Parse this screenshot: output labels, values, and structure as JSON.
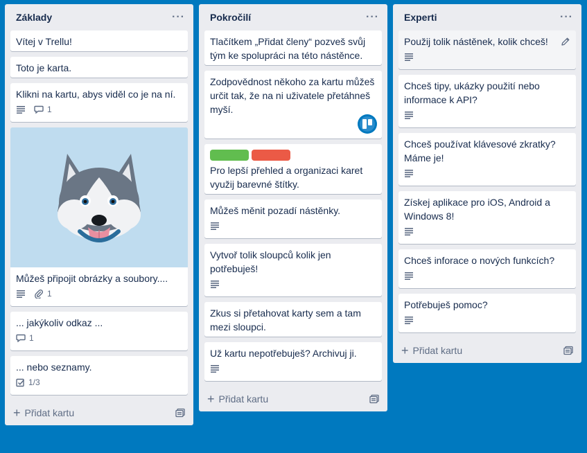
{
  "lists": [
    {
      "title": "Základy",
      "menu": "···",
      "cards": [
        {
          "text": "Vítej v Trellu!"
        },
        {
          "text": "Toto je karta."
        },
        {
          "text": "Klikni na kartu, abys viděl co je na ní.",
          "comments": "1"
        },
        {
          "text": "Můžeš připojit obrázky a soubory....",
          "attachments": "1"
        },
        {
          "text": "... jakýkoliv odkaz ...",
          "comments": "1"
        },
        {
          "text": "... nebo seznamy.",
          "checklist": "1/3"
        }
      ],
      "add_card": "Přidat kartu"
    },
    {
      "title": "Pokročilí",
      "menu": "···",
      "cards": [
        {
          "text": "Tlačítkem „Přidat členy“ pozveš svůj tým ke spolupráci na této nástěnce."
        },
        {
          "text": "Zodpovědnost někoho za kartu můžeš určit tak, že na ni uživatele přetáhneš myší."
        },
        {
          "text": "Pro lepší přehled a organizaci karet využij barevné štítky."
        },
        {
          "text": "Můžeš měnit pozadí nástěnky."
        },
        {
          "text": "Vytvoř tolik sloupců kolik jen potřebuješ!"
        },
        {
          "text": "Zkus si přetahovat karty sem a tam mezi sloupci."
        },
        {
          "text": "Už kartu nepotřebuješ? Archivuj ji."
        }
      ],
      "add_card": "Přidat kartu"
    },
    {
      "title": "Experti",
      "menu": "···",
      "cards": [
        {
          "text": "Použij tolik nástěnek, kolik chceš!"
        },
        {
          "text": "Chceš tipy, ukázky použití nebo informace k API?"
        },
        {
          "text": "Chceš používat klávesové zkratky? Máme je!"
        },
        {
          "text": "Získej aplikace pro iOS, Android a Windows 8!"
        },
        {
          "text": "Chceš inforace o nových funkcích?"
        },
        {
          "text": "Potřebuješ pomoc?"
        }
      ],
      "add_card": "Přidat kartu"
    }
  ],
  "colors": {
    "board_bg": "#0079bf",
    "list_bg": "#ebecf0",
    "label_green": "#61bd4f",
    "label_red": "#eb5a46",
    "cover_bg": "#bfdcef"
  },
  "icons": [
    "description-icon",
    "comment-icon",
    "attachment-icon",
    "checklist-icon",
    "edit-pencil-icon",
    "template-icon",
    "plus-icon",
    "member-avatar-icon",
    "husky-image"
  ]
}
